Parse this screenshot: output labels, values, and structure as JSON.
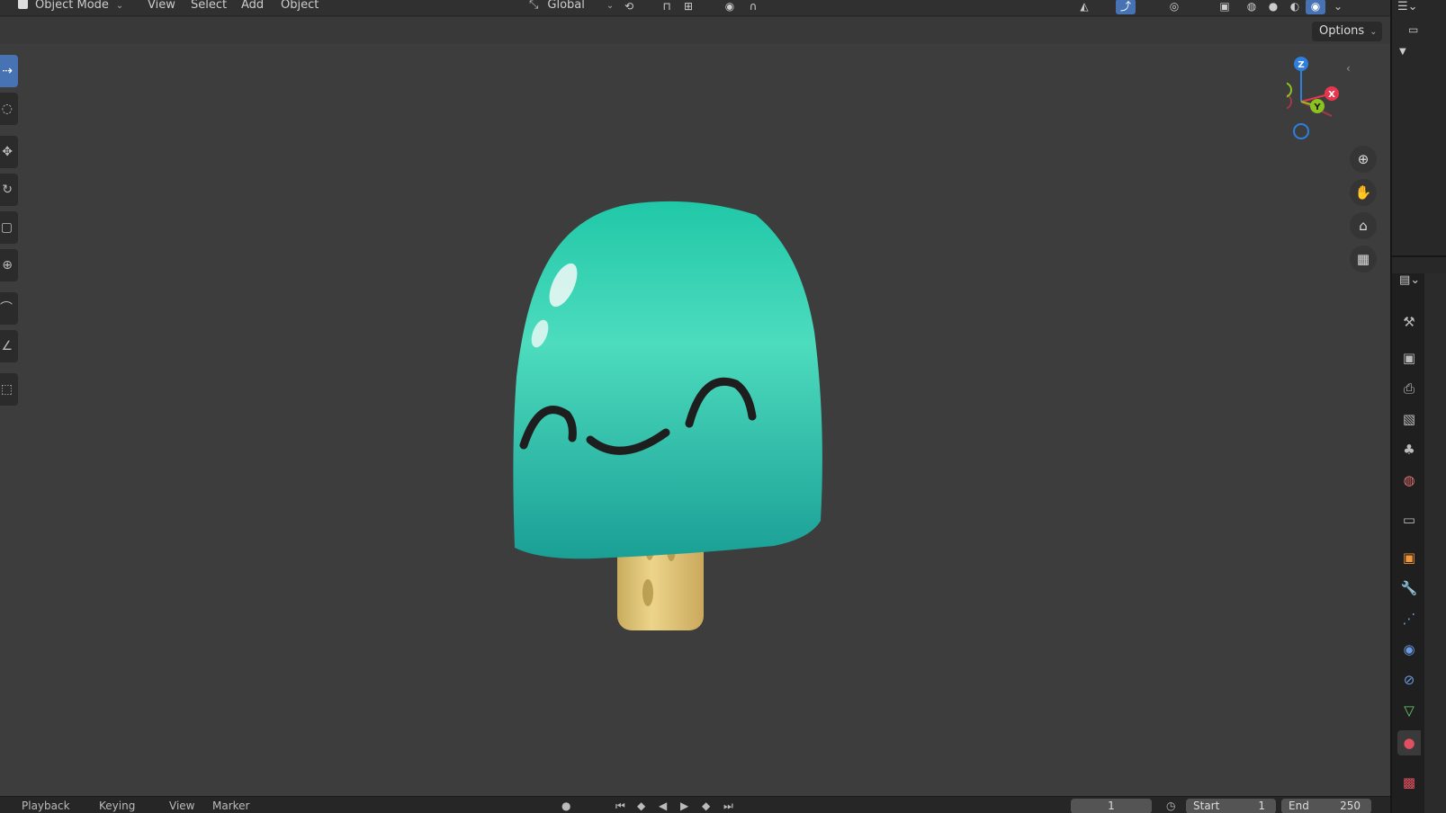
{
  "header": {
    "mode": "Object Mode",
    "menus": [
      "View",
      "Select",
      "Add",
      "Object"
    ],
    "orientation": "Global"
  },
  "viewport": {
    "options_label": "Options",
    "gizmo_axes": {
      "z": "Z",
      "x": "X",
      "y": "Y"
    }
  },
  "timeline": {
    "menus": [
      "Playback",
      "Keying",
      "View",
      "Marker"
    ],
    "current_frame": "1",
    "start_label": "Start",
    "start_value": "1",
    "end_label": "End",
    "end_value": "250"
  },
  "colors": {
    "accent": "#4772b3",
    "axis_x": "#e8364f",
    "axis_y": "#8bc21f",
    "axis_z": "#2e7fe0",
    "popsicle": "#2fd3b5",
    "stick": "#e4c97a"
  },
  "properties_tabs": [
    "tool",
    "render",
    "output",
    "view-layer",
    "scene",
    "world",
    "collection",
    "object",
    "modifier",
    "particles",
    "physics",
    "constraints",
    "data",
    "material",
    "texture"
  ]
}
